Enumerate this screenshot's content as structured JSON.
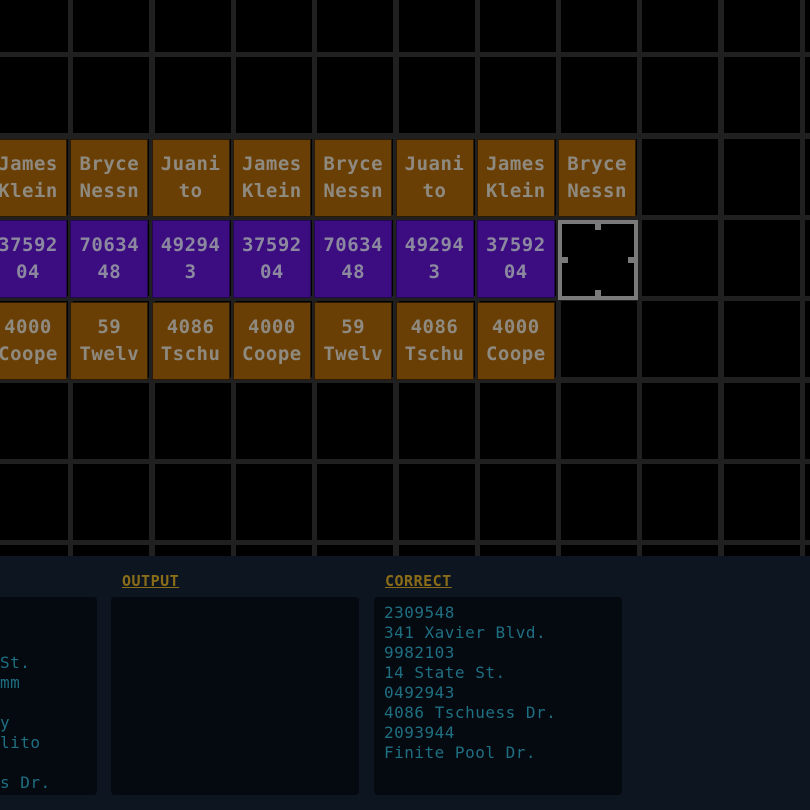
{
  "grid": {
    "rows": [
      {
        "kind": "name",
        "tiles": [
          [
            "James",
            "Klein"
          ],
          [
            "Bryce",
            "Nessn"
          ],
          [
            "Juani",
            "to"
          ],
          [
            "James",
            "Klein"
          ],
          [
            "Bryce",
            "Nessn"
          ],
          [
            "Juani",
            "to"
          ],
          [
            "James",
            "Klein"
          ],
          [
            "Bryce",
            "Nessn"
          ]
        ]
      },
      {
        "kind": "num",
        "tiles": [
          [
            "37592",
            "04"
          ],
          [
            "70634",
            "48"
          ],
          [
            "49294",
            "3"
          ],
          [
            "37592",
            "04"
          ],
          [
            "70634",
            "48"
          ],
          [
            "49294",
            "3"
          ],
          [
            "37592",
            "04"
          ]
        ]
      },
      {
        "kind": "addr",
        "tiles": [
          [
            "4000",
            "Coope"
          ],
          [
            "59",
            "Twelv"
          ],
          [
            "4086",
            "Tschu"
          ],
          [
            "4000",
            "Coope"
          ],
          [
            "59",
            "Twelv"
          ],
          [
            "4086",
            "Tschu"
          ],
          [
            "4000",
            "Coope"
          ]
        ]
      }
    ]
  },
  "panels": {
    "input_lines": [
      "",
      "",
      "St.",
      "mm",
      "",
      "y",
      "lito",
      "",
      "s Dr."
    ],
    "output": {
      "title": "OUTPUT",
      "lines": []
    },
    "correct": {
      "title": "CORRECT",
      "lines": [
        "2309548",
        "341 Xavier Blvd.",
        "9982103",
        "14 State St.",
        "0492943",
        "4086 Tschuess Dr.",
        "2093944",
        "Finite Pool Dr."
      ]
    }
  },
  "colors": {
    "name_tile": "#6a3f05",
    "number_tile": "#3b0d80",
    "address_tile": "#6a3f05",
    "panel_title": "#8a6d18",
    "panel_text": "#1f6f82",
    "cursor": "#7a7a7a"
  }
}
